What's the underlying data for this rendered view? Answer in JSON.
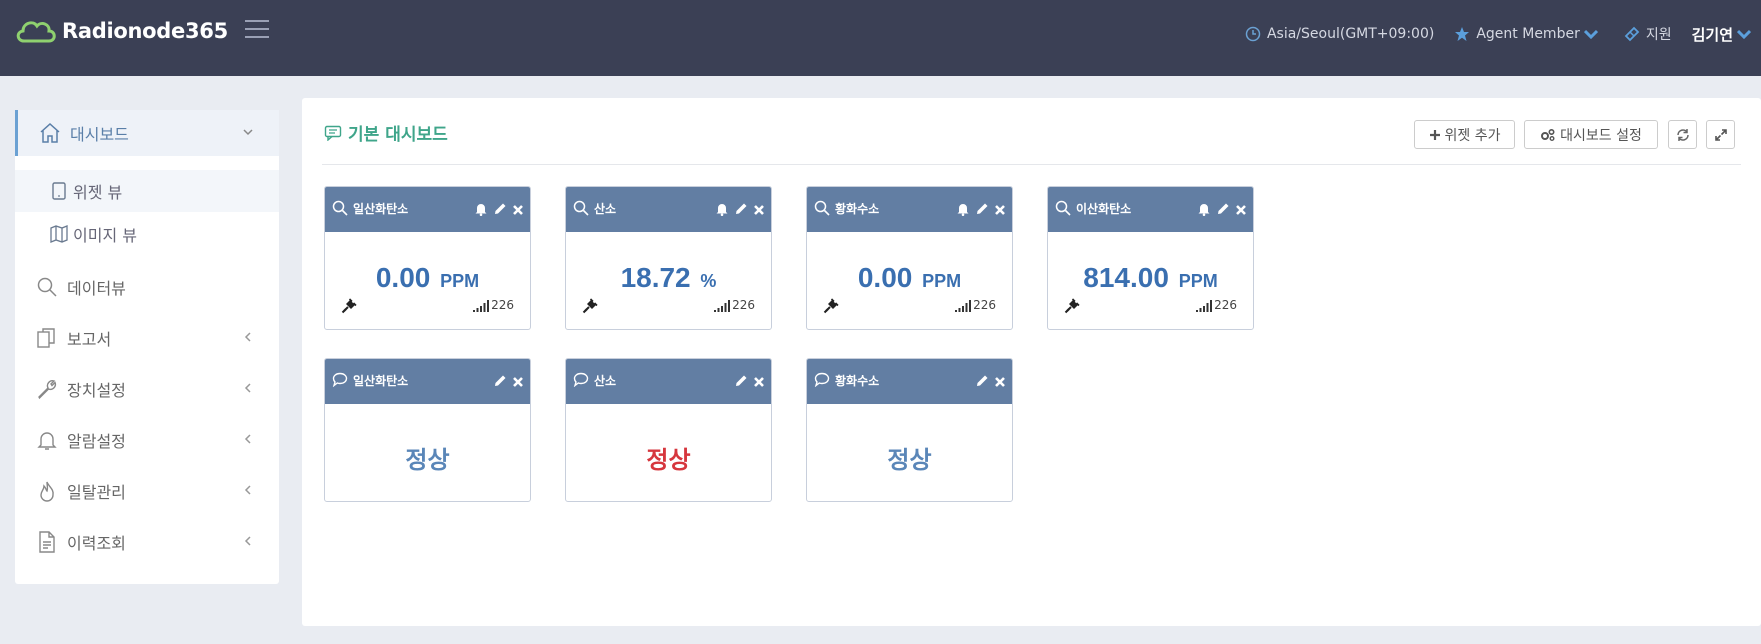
{
  "header": {
    "logo_text": "Radionode365",
    "timezone": "Asia/Seoul(GMT+09:00)",
    "member": "Agent Member",
    "support": "지원",
    "user": "김기연"
  },
  "sidebar": {
    "items": [
      {
        "label": "대시보드"
      },
      {
        "label": "위젯 뷰"
      },
      {
        "label": "이미지 뷰"
      },
      {
        "label": "데이터뷰"
      },
      {
        "label": "보고서"
      },
      {
        "label": "장치설정"
      },
      {
        "label": "알람설정"
      },
      {
        "label": "일탈관리"
      },
      {
        "label": "이력조회"
      }
    ]
  },
  "main": {
    "title": "기본 대시보드",
    "add_widget": "위젯 추가",
    "dashboard_settings": "대시보드 설정"
  },
  "sensor_widgets": [
    {
      "title": "일산화탄소",
      "value": "0.00",
      "unit": "PPM",
      "signal": "226"
    },
    {
      "title": "산소",
      "value": "18.72",
      "unit": "%",
      "signal": "226"
    },
    {
      "title": "황화수소",
      "value": "0.00",
      "unit": "PPM",
      "signal": "226"
    },
    {
      "title": "이산화탄소",
      "value": "814.00",
      "unit": "PPM",
      "signal": "226"
    }
  ],
  "status_widgets": [
    {
      "title": "일산화탄소",
      "status": "정상",
      "color": "#5a86b8"
    },
    {
      "title": "산소",
      "status": "정상",
      "color": "#d6363d"
    },
    {
      "title": "황화수소",
      "status": "정상",
      "color": "#5a86b8"
    }
  ],
  "colors": {
    "header_bg": "#3b4055",
    "widget_header": "#627ea3",
    "value_blue": "#3a6fb0",
    "title_green": "#3fa58a"
  }
}
